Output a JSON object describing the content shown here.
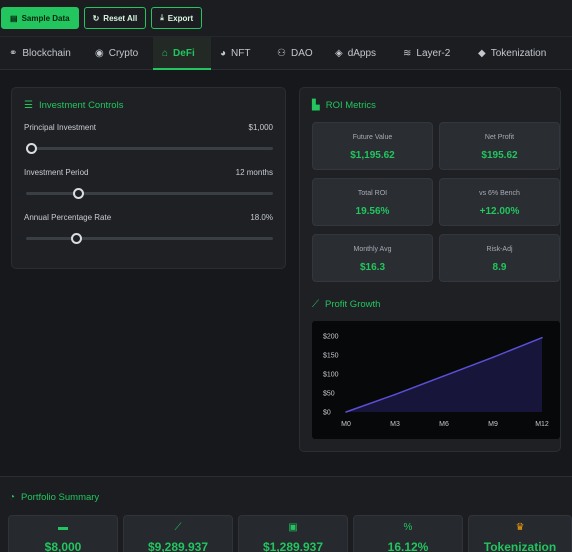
{
  "toolbar": {
    "sample_label": "Sample Data",
    "reset_label": "Reset All",
    "export_label": "Export"
  },
  "tabs": [
    {
      "label": "Blockchain",
      "icon": "link-icon"
    },
    {
      "label": "Crypto",
      "icon": "coins-icon"
    },
    {
      "label": "DeFi",
      "icon": "bank-icon",
      "active": true
    },
    {
      "label": "NFT",
      "icon": "palette-icon"
    },
    {
      "label": "DAO",
      "icon": "users-icon"
    },
    {
      "label": "dApps",
      "icon": "cube-icon"
    },
    {
      "label": "Layer-2",
      "icon": "layers-icon"
    },
    {
      "label": "Tokenization",
      "icon": "gem-icon"
    }
  ],
  "controls": {
    "title": "Investment Controls",
    "principal": {
      "label": "Principal Investment",
      "value": "$1,000",
      "level": 0.0
    },
    "period": {
      "label": "Investment Period",
      "value": "12 months",
      "level": 0.2
    },
    "apr": {
      "label": "Annual Percentage Rate",
      "value": "18.0%",
      "level": 0.19
    }
  },
  "roi": {
    "title": "ROI Metrics",
    "metrics": [
      {
        "label": "Future Value",
        "value": "$1,195.62"
      },
      {
        "label": "Net Profit",
        "value": "$195.62"
      },
      {
        "label": "Total ROI",
        "value": "19.56%"
      },
      {
        "label": "vs 6% Bench",
        "value": "+12.00%"
      },
      {
        "label": "Monthly Avg",
        "value": "$16.3"
      },
      {
        "label": "Risk-Adj",
        "value": "8.9"
      }
    ]
  },
  "growth": {
    "title": "Profit Growth"
  },
  "chart_data": {
    "type": "area",
    "x": [
      "M0",
      "M3",
      "M6",
      "M9",
      "M12"
    ],
    "y_ticks": [
      "$0",
      "$50",
      "$100",
      "$150",
      "$200"
    ],
    "ylim": [
      0,
      200
    ],
    "series": [
      {
        "values": [
          0,
          46,
          95,
          144,
          195.62
        ]
      }
    ],
    "colors": {
      "line": "#5b4fd6",
      "fill": "#17153a"
    }
  },
  "portfolio": {
    "title": "Portfolio Summary",
    "cards": [
      {
        "icon": "wallet-icon",
        "value": "$8,000"
      },
      {
        "icon": "chart-line-icon",
        "value": "$9,289.937"
      },
      {
        "icon": "money-icon",
        "value": "$1,289.937"
      },
      {
        "icon": "percent-icon",
        "value": "16.12%"
      },
      {
        "icon": "trophy-icon",
        "value": "Tokenization"
      }
    ]
  },
  "colors": {
    "accent": "#22c55e",
    "background": "#16181c",
    "panel": "#1e2024",
    "trophy": "#f59e0b"
  }
}
